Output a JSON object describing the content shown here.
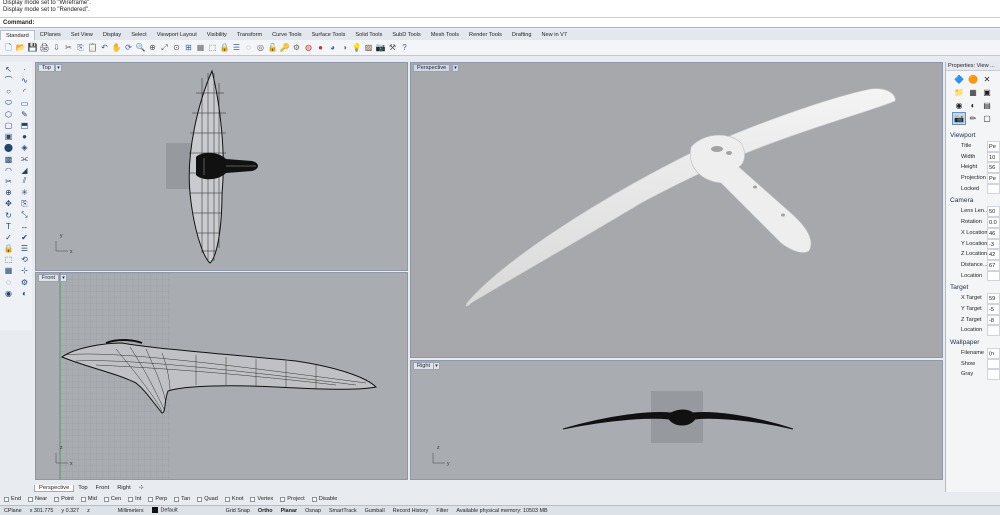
{
  "command_history": [
    "Display mode set to \"Wireframe\".",
    "Display mode set to \"Rendered\"."
  ],
  "command_prompt": "Command:",
  "ribbon_tabs": [
    "Standard",
    "CPlanes",
    "Set View",
    "Display",
    "Select",
    "Viewport Layout",
    "Visibility",
    "Transform",
    "Curve Tools",
    "Surface Tools",
    "Solid Tools",
    "SubD Tools",
    "Mesh Tools",
    "Render Tools",
    "Drafting",
    "New in V7"
  ],
  "active_tab": "Standard",
  "toolbar_icons": [
    "new-file-icon",
    "open-file-icon",
    "save-icon",
    "print-icon",
    "import-icon",
    "cut-icon",
    "copy-icon",
    "paste-icon",
    "undo-icon",
    "pan-icon",
    "rotate-view-icon",
    "zoom-icon",
    "zoom-window-icon",
    "zoom-extents-icon",
    "zoom-selected-icon",
    "four-viewports-icon",
    "grid-icon",
    "select-icon",
    "lock-icon",
    "layer-icon",
    "hide-icon",
    "show-icon",
    "lock-object-icon",
    "unlock-icon",
    "properties-icon",
    "color-wheel-icon",
    "render-sphere-icon",
    "material-sphere-icon",
    "environment-sphere-icon",
    "light-icon",
    "texture-icon",
    "camera-icon",
    "settings-icon",
    "help-icon"
  ],
  "left_tool_icons": [
    "select-arrow-icon",
    "point-icon",
    "polyline-icon",
    "curve-icon",
    "circle-icon",
    "arc-icon",
    "ellipse-icon",
    "rectangle-icon",
    "polygon-icon",
    "freeform-icon",
    "surface-icon",
    "extrude-icon",
    "box-icon",
    "sphere-icon",
    "cylinder-icon",
    "boolean-icon",
    "mesh-icon",
    "offset-icon",
    "fillet-icon",
    "chamfer-icon",
    "trim-icon",
    "split-icon",
    "join-icon",
    "explode-icon",
    "move-icon",
    "copy-icon",
    "rotate-icon",
    "scale-icon",
    "text-icon",
    "dimension-icon",
    "analyze-icon",
    "check-icon",
    "lock-icon",
    "layer-icon",
    "block-icon",
    "history-icon",
    "grid-icon",
    "snap-icon",
    "hide-icon",
    "properties-icon",
    "render-icon",
    "materials-icon"
  ],
  "viewports": {
    "top": {
      "title": "Top"
    },
    "front": {
      "title": "Front"
    },
    "perspective": {
      "title": "Perspective"
    },
    "right": {
      "title": "Right"
    }
  },
  "axis_labels": {
    "x": "x",
    "y": "y",
    "z": "z"
  },
  "properties": {
    "header": "Properties: View ...",
    "viewport_section": "Viewport",
    "viewport_rows": [
      {
        "label": "Title",
        "value": "Pe"
      },
      {
        "label": "Width",
        "value": "10"
      },
      {
        "label": "Height",
        "value": "56"
      },
      {
        "label": "Projection",
        "value": "Pe"
      },
      {
        "label": "Locked",
        "value": ""
      }
    ],
    "camera_section": "Camera",
    "camera_rows": [
      {
        "label": "Lens Len...",
        "value": "50"
      },
      {
        "label": "Rotation",
        "value": "0.0"
      },
      {
        "label": "X Location",
        "value": "46"
      },
      {
        "label": "Y Location",
        "value": "-3"
      },
      {
        "label": "Z Location",
        "value": "42"
      },
      {
        "label": "Distance...",
        "value": "67"
      },
      {
        "label": "Location",
        "value": ""
      }
    ],
    "target_section": "Target",
    "target_rows": [
      {
        "label": "X Target",
        "value": "59"
      },
      {
        "label": "Y Target",
        "value": "-5"
      },
      {
        "label": "Z Target",
        "value": "-8"
      },
      {
        "label": "Location",
        "value": ""
      }
    ],
    "wallpaper_section": "Wallpaper",
    "wallpaper_rows": [
      {
        "label": "Filename",
        "value": "(n"
      },
      {
        "label": "Show",
        "value": ""
      },
      {
        "label": "Gray",
        "value": ""
      }
    ]
  },
  "viewport_tabs": [
    "Perspective",
    "Top",
    "Front",
    "Right"
  ],
  "active_viewport_tab": "Perspective",
  "osnaps": [
    "End",
    "Near",
    "Point",
    "Mid",
    "Cen",
    "Int",
    "Perp",
    "Tan",
    "Quad",
    "Knot",
    "Vertex",
    "Project",
    "Disable"
  ],
  "status": {
    "cplane": "CPlane",
    "x": "x 301.775",
    "y": "y 0.327",
    "z": "z",
    "units": "Millimeters",
    "layer": "Default",
    "grid_snap": "Grid Snap",
    "ortho": "Ortho",
    "planar": "Planar",
    "osnap": "Osnap",
    "smarttrack": "SmartTrack",
    "gumball": "Gumball",
    "record_history": "Record History",
    "filter": "Filter",
    "memory": "Available physical memory: 10503 MB"
  }
}
